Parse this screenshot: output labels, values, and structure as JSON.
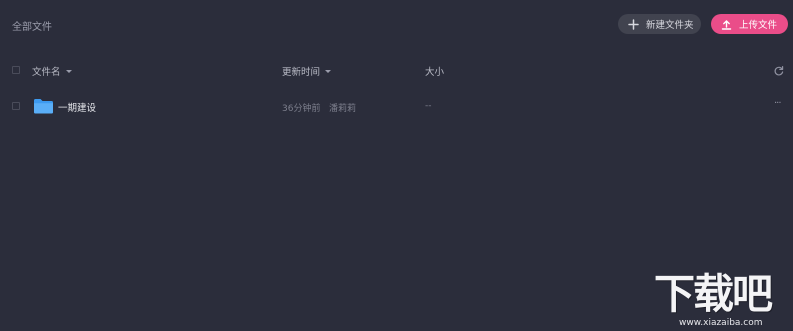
{
  "breadcrumb": {
    "label": "全部文件"
  },
  "toolbar": {
    "new_folder_label": "新建文件夹",
    "upload_label": "上传文件",
    "new_folder_icon": "plus-icon",
    "upload_icon": "upload-icon"
  },
  "table": {
    "columns": {
      "name": "文件名",
      "updated": "更新时间",
      "size": "大小"
    },
    "rows": [
      {
        "icon": "folder-icon",
        "name": "一期建设",
        "time": "36分钟前",
        "user": "潘莉莉",
        "size": "--",
        "actions": "···"
      }
    ]
  },
  "watermark": {
    "title": "下载吧",
    "url": "www.xiazaiba.com"
  },
  "colors": {
    "background": "#2b2d3b",
    "accent": "#ea4d89",
    "folder": "#3d9af0",
    "secondary_button": "#41434f"
  }
}
